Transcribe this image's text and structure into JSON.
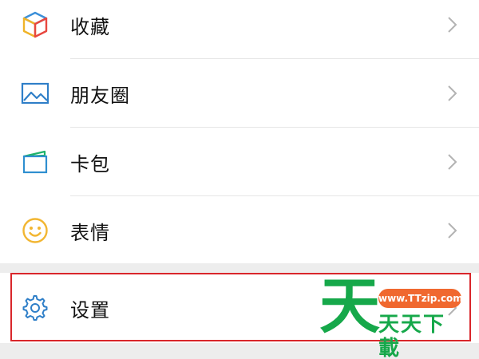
{
  "menu": {
    "items": [
      {
        "label": "收藏",
        "icon": "cube-icon"
      },
      {
        "label": "朋友圈",
        "icon": "picture-icon"
      },
      {
        "label": "卡包",
        "icon": "card-icon"
      },
      {
        "label": "表情",
        "icon": "smiley-icon"
      }
    ],
    "settings": {
      "label": "设置",
      "icon": "gear-icon"
    }
  },
  "watermark": {
    "big_char": "天",
    "url": "www.TTzip.com",
    "name": "天天下載"
  },
  "colors": {
    "highlight": "#d9262b",
    "watermark_green": "#16a84a",
    "watermark_orange": "#f0682f",
    "icon_blue": "#2f7fc8"
  }
}
